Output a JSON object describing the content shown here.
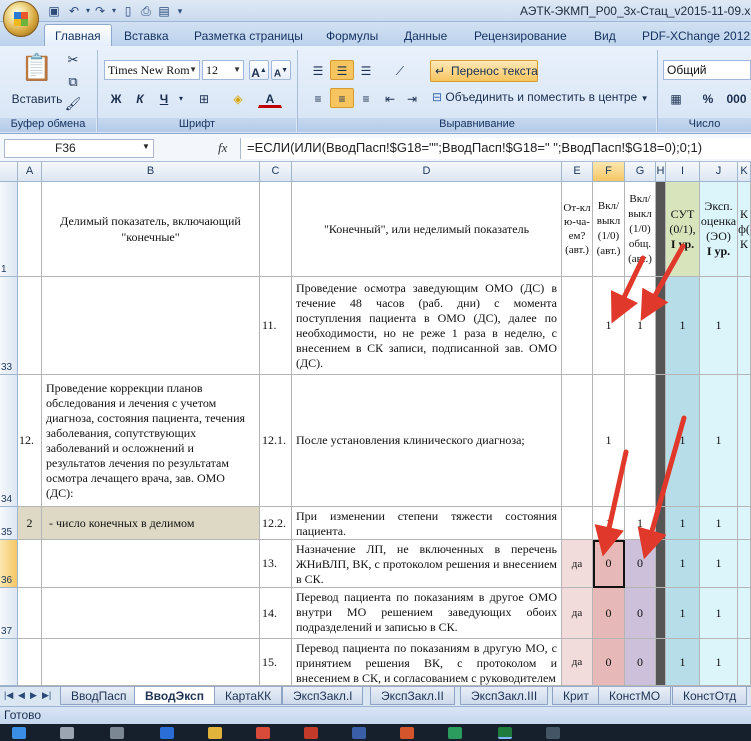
{
  "window": {
    "title": "АЭТК-ЭКМП_Р00_3х-Стац_v2015-11-09.xlsx"
  },
  "ribbon_tabs": [
    "Главная",
    "Вставка",
    "Разметка страницы",
    "Формулы",
    "Данные",
    "Рецензирование",
    "Вид",
    "PDF-XChange 2012"
  ],
  "clipboard": {
    "paste_label": "Вставить",
    "group_label": "Буфер обмена"
  },
  "font": {
    "name": "Times New Rom",
    "size": "12",
    "bold": "Ж",
    "italic": "К",
    "underline": "Ч",
    "group_label": "Шрифт"
  },
  "alignment": {
    "wrap_text": "Перенос текста",
    "merge_center": "Объединить и поместить в центре",
    "group_label": "Выравнивание"
  },
  "number": {
    "format": "Общий",
    "group_label": "Число",
    "percent": "%",
    "thousands": "000"
  },
  "formula_bar": {
    "cell_ref": "F36",
    "fx": "fx",
    "formula": "=ЕСЛИ(ИЛИ(ВводПасп!$G18=\"\";ВводПасп!$G18=\" \";ВводПасп!$G18=0);0;1)"
  },
  "columns": [
    "A",
    "B",
    "C",
    "D",
    "E",
    "F",
    "G",
    "H",
    "I",
    "J",
    "K"
  ],
  "header_row": {
    "row": "1",
    "b": "Делимый показатель, включающий \"конечные\"",
    "d": "\"Конечный\", или неделимый показатель",
    "e": "От-клю-ча-ем? (авт.)",
    "f": "Вкл/ выкл (1/0) (авт.)",
    "g": "Вкл/ выкл (1/0) общ. (авт.)",
    "i_main": "СУТ (0/1),",
    "i_level": "I ур.",
    "k_main": "Эксп. оценка (ЭО)",
    "k_level": "I ур.",
    "l": "К ф( К"
  },
  "rows": [
    {
      "row": "33",
      "a": "",
      "b": "",
      "c": "11.",
      "d": "Проведение осмотра заведующим ОМО (ДС) в течение 48 часов (раб. дни) с момента поступления пациента в ОМО (ДС), далее по необходимости, но не реже 1 раза в неделю, с внесением в СК записи, подписанной зав. ОМО (ДС).",
      "e": "",
      "f": "1",
      "g": "1",
      "i": "1",
      "k": "1"
    },
    {
      "row": "34",
      "a": "12.",
      "b": "Проведение коррекции планов обследования и лечения с учетом диагноза, состояния пациента, течения заболевания, сопутствующих заболеваний и осложнений и результатов лечения по результатам осмотра лечащего врача, зав. ОМО (ДС):",
      "c": "12.1.",
      "d": "После установления клинического диагноза;",
      "e": "",
      "f": "1",
      "g": "",
      "i": "1",
      "k": "1"
    },
    {
      "row": "35",
      "a": "2",
      "b": " - число конечных в делимом",
      "c": "12.2.",
      "d": "При изменении степени тяжести состояния пациента.",
      "e": "",
      "f": "1",
      "g": "1",
      "i": "1",
      "k": "1"
    },
    {
      "row": "36",
      "a": "",
      "b": "",
      "c": "13.",
      "d": "Назначение ЛП, не включенных в перечень ЖНиВЛП, ВК, с протоколом решения и внесением в СК.",
      "e": "да",
      "f": "0",
      "g": "0",
      "i": "1",
      "k": "1"
    },
    {
      "row": "37",
      "a": "",
      "b": "",
      "c": "14.",
      "d": "Перевод пациента по показаниям в другое ОМО внутри МО решением заведующих обоих подразделений и записью в СК.",
      "e": "да",
      "f": "0",
      "g": "0",
      "i": "1",
      "k": "1"
    },
    {
      "row": "38",
      "a": "",
      "b": "",
      "c": "15.",
      "d": "Перевод пациента по показаниям в другую МО, с принятием решения ВК, с протоколом и внесением в СК, и согласованием с руководителем",
      "e": "да",
      "f": "0",
      "g": "0",
      "i": "1",
      "k": "1"
    }
  ],
  "sheet_tabs": [
    "ВводПасп",
    "ВводЭксп",
    "КартаКК",
    "ЭкспЗакл.I",
    "ЭкспЗакл.II",
    "ЭкспЗакл.III",
    "Крит",
    "КонстМО",
    "КонстОтд"
  ],
  "active_sheet": "ВводЭксп",
  "status": {
    "text": "Готово"
  },
  "colors": {
    "annotation_arrow": "#e0392b",
    "selected_header": "#f5c765"
  }
}
